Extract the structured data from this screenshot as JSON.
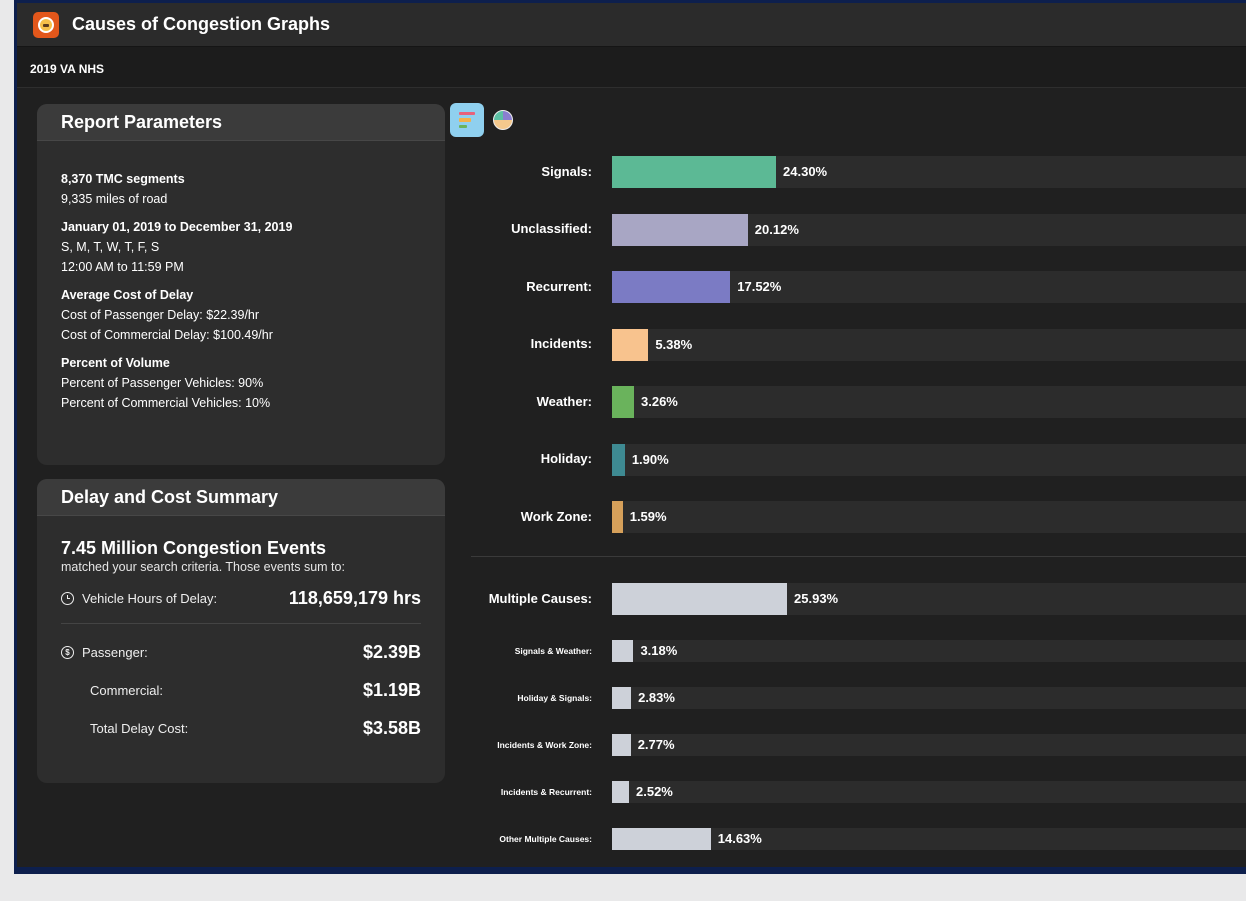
{
  "window": {
    "title": "Causes of Congestion Graphs",
    "subtitle": "2019 VA NHS"
  },
  "params": {
    "heading": "Report Parameters",
    "segments": "8,370 TMC segments",
    "miles": "9,335 miles of road",
    "date_range": "January 01, 2019 to December 31, 2019",
    "days": "S, M, T, W, T, F, S",
    "time_range": "12:00 AM to 11:59 PM",
    "cost_heading": "Average Cost of Delay",
    "passenger_cost": "Cost of Passenger Delay: $22.39/hr",
    "commercial_cost": "Cost of Commercial Delay: $100.49/hr",
    "volume_heading": "Percent of Volume",
    "passenger_pct": "Percent of Passenger Vehicles: 90%",
    "commercial_pct": "Percent of Commercial Vehicles: 10%"
  },
  "summary": {
    "heading": "Delay and Cost Summary",
    "events_title": "7.45 Million Congestion Events",
    "events_sub": "matched your search criteria. Those events sum to:",
    "hours_label": "Vehicle Hours of Delay:",
    "hours_value": "118,659,179 hrs",
    "passenger_label": "Passenger:",
    "passenger_value": "$2.39B",
    "commercial_label": "Commercial:",
    "commercial_value": "$1.19B",
    "total_label": "Total Delay Cost:",
    "total_value": "$3.58B",
    "icons": {
      "hours": "clock-icon",
      "passenger": "dollar-icon"
    }
  },
  "chart_toggle": {
    "bar": "bar-chart-icon",
    "pie": "pie-chart-icon",
    "active": "bar"
  },
  "chart_data": {
    "type": "bar",
    "orientation": "horizontal",
    "xlim": [
      0,
      100
    ],
    "groups": [
      {
        "bars": [
          {
            "label": "Signals:",
            "value": 24.3,
            "display": "24.30%",
            "color": "#5cb995"
          },
          {
            "label": "Unclassified:",
            "value": 20.12,
            "display": "20.12%",
            "color": "#a8a6c4"
          },
          {
            "label": "Recurrent:",
            "value": 17.52,
            "display": "17.52%",
            "color": "#7b7bc4"
          },
          {
            "label": "Incidents:",
            "value": 5.38,
            "display": "5.38%",
            "color": "#f8c38e"
          },
          {
            "label": "Weather:",
            "value": 3.26,
            "display": "3.26%",
            "color": "#6ab35c"
          },
          {
            "label": "Holiday:",
            "value": 1.9,
            "display": "1.90%",
            "color": "#3e8a92"
          },
          {
            "label": "Work Zone:",
            "value": 1.59,
            "display": "1.59%",
            "color": "#d6a05a"
          }
        ]
      },
      {
        "bars": [
          {
            "label": "Multiple Causes:",
            "value": 25.93,
            "display": "25.93%",
            "color": "#cdd1d9",
            "major": true
          },
          {
            "label": "Signals & Weather:",
            "value": 3.18,
            "display": "3.18%",
            "color": "#cdd1d9"
          },
          {
            "label": "Holiday & Signals:",
            "value": 2.83,
            "display": "2.83%",
            "color": "#cdd1d9"
          },
          {
            "label": "Incidents & Work Zone:",
            "value": 2.77,
            "display": "2.77%",
            "color": "#cdd1d9"
          },
          {
            "label": "Incidents & Recurrent:",
            "value": 2.52,
            "display": "2.52%",
            "color": "#cdd1d9"
          },
          {
            "label": "Other Multiple Causes:",
            "value": 14.63,
            "display": "14.63%",
            "color": "#cdd1d9"
          }
        ]
      }
    ]
  }
}
